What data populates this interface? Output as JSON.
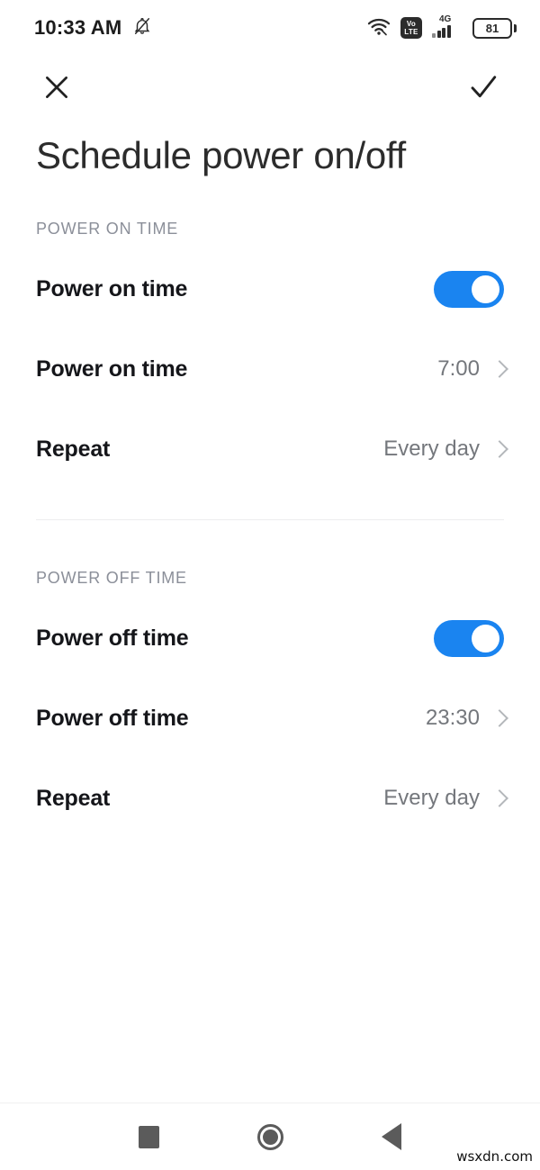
{
  "status_bar": {
    "clock": "10:33 AM",
    "silent_icon": "bell-muted-icon",
    "wifi_icon": "wifi-icon",
    "volte_line1": "Vo",
    "volte_line2": "LTE",
    "network_type": "4G",
    "signal_icon": "signal-bars-icon",
    "battery_level": "81"
  },
  "action_bar": {
    "close_label": "close-icon",
    "confirm_label": "check-icon"
  },
  "page": {
    "title": "Schedule power on/off"
  },
  "sections": [
    {
      "header": "POWER ON TIME",
      "rows": [
        {
          "label": "Power on time",
          "control": "toggle",
          "toggle_state": "on"
        },
        {
          "label": "Power on time",
          "control": "value",
          "value": "7:00"
        },
        {
          "label": "Repeat",
          "control": "value",
          "value": "Every day"
        }
      ]
    },
    {
      "header": "POWER OFF TIME",
      "rows": [
        {
          "label": "Power off time",
          "control": "toggle",
          "toggle_state": "on"
        },
        {
          "label": "Power off time",
          "control": "value",
          "value": "23:30"
        },
        {
          "label": "Repeat",
          "control": "value",
          "value": "Every day"
        }
      ]
    }
  ],
  "nav_bar": {
    "recents": "recents-square-icon",
    "home": "home-circle-icon",
    "back": "back-triangle-icon"
  },
  "watermark": "wsxdn.com",
  "colors": {
    "accent": "#1a84f0",
    "label": "#15161a",
    "value": "#74777c",
    "section_header": "#8b8f99",
    "background": "#ffffff"
  }
}
